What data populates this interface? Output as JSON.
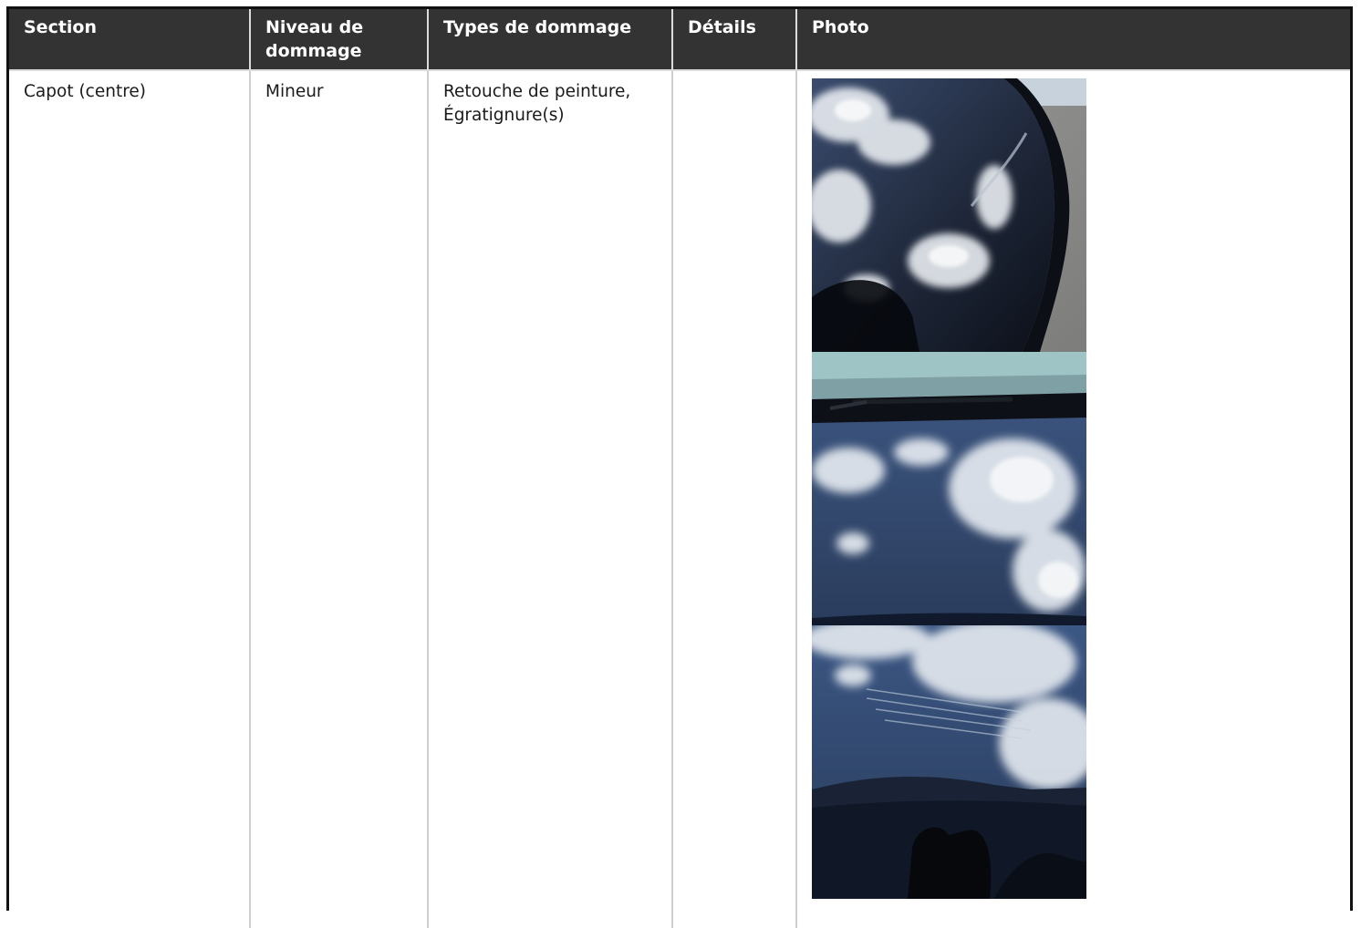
{
  "table": {
    "headers": {
      "section": "Section",
      "level": "Niveau de dommage",
      "types": "Types de dommage",
      "details": "Détails",
      "photo": "Photo"
    },
    "rows": [
      {
        "section": "Capot (centre)",
        "level": "Mineur",
        "types": "Retouche de peinture, Égratignure(s)",
        "details": "",
        "photos": [
          "hood-photo-reflection-curve",
          "hood-photo-wiper-clouds",
          "hood-photo-scratches-clouds"
        ]
      }
    ]
  },
  "colors": {
    "header_bg": "#333333",
    "header_text": "#ffffff",
    "grid_line": "#cfcfcf",
    "frame": "#111111"
  }
}
